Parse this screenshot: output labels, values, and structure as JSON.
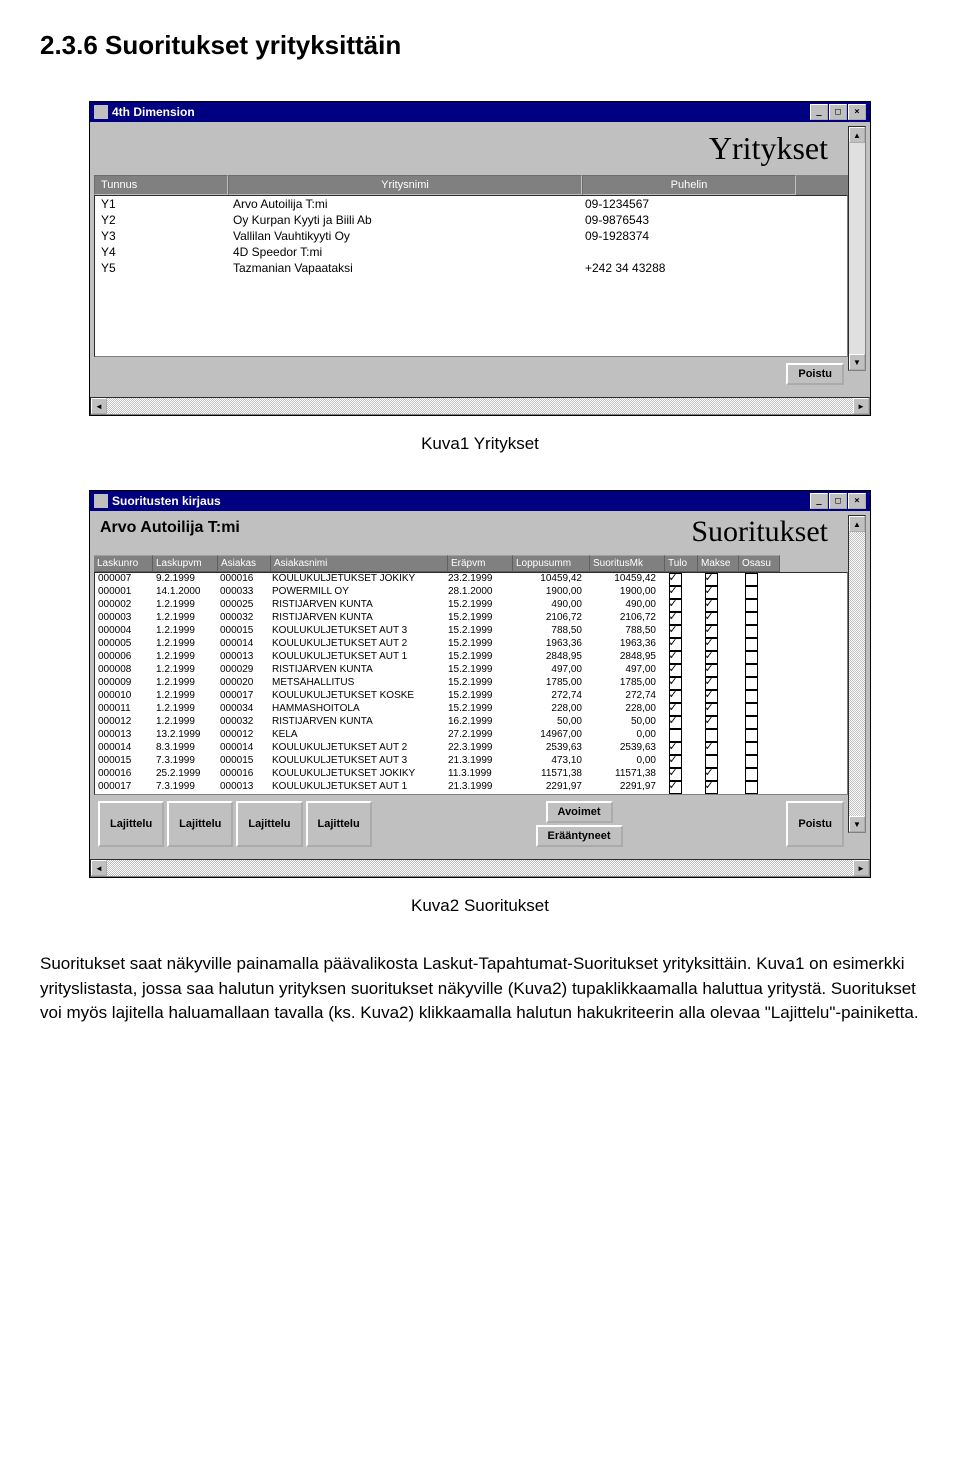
{
  "heading": "2.3.6  Suoritukset yrityksittäin",
  "caption1": "Kuva1 Yritykset",
  "caption2": "Kuva2 Suoritukset",
  "bodytext": "Suoritukset saat näkyville painamalla päävalikosta Laskut-Tapahtumat-Suoritukset yrityksittäin. Kuva1 on esimerkki yrityslistasta, jossa saa halutun yrityksen suoritukset näkyville (Kuva2) tupaklikkaamalla haluttua yritystä. Suoritukset voi myös lajitella haluamallaan tavalla (ks. Kuva2) klikkaamalla halutun hakukriteerin alla olevaa \"Lajittelu\"-painiketta.",
  "win1": {
    "title": "4th Dimension",
    "bigtitle": "Yritykset",
    "headers": [
      "Tunnus",
      "Yritysnimi",
      "Puhelin"
    ],
    "rows": [
      [
        "Y1",
        "Arvo Autoilija T:mi",
        "09-1234567"
      ],
      [
        "Y2",
        "Oy Kurpan Kyyti ja Biili Ab",
        "09-9876543"
      ],
      [
        "Y3",
        "Vallilan Vauhtikyyti Oy",
        "09-1928374"
      ],
      [
        "Y4",
        "4D Speedor T:mi",
        ""
      ],
      [
        "Y5",
        "Tazmanian Vapaataksi",
        "+242 34 43288"
      ]
    ],
    "poistu": "Poistu"
  },
  "win2": {
    "title": "Suoritusten kirjaus",
    "company": "Arvo Autoilija T:mi",
    "bigtitle": "Suoritukset",
    "headers": [
      "Laskunro",
      "Laskupvm",
      "Asiakas",
      "Asiakasnimi",
      "Eräpvm",
      "Loppusumm",
      "SuoritusMk",
      "Tulo",
      "Makse",
      "Osasu"
    ],
    "rows": [
      [
        "000007",
        "9.2.1999",
        "000016",
        "KOULUKULJETUKSET JOKIKY",
        "23.2.1999",
        "10459,42",
        "10459,42",
        true,
        true,
        false
      ],
      [
        "000001",
        "14.1.2000",
        "000033",
        "POWERMILL OY",
        "28.1.2000",
        "1900,00",
        "1900,00",
        true,
        true,
        false
      ],
      [
        "000002",
        "1.2.1999",
        "000025",
        "RISTIJÄRVEN KUNTA",
        "15.2.1999",
        "490,00",
        "490,00",
        true,
        true,
        false
      ],
      [
        "000003",
        "1.2.1999",
        "000032",
        "RISTIJÄRVEN KUNTA",
        "15.2.1999",
        "2106,72",
        "2106,72",
        true,
        true,
        false
      ],
      [
        "000004",
        "1.2.1999",
        "000015",
        "KOULUKULJETUKSET AUT 3",
        "15.2.1999",
        "788,50",
        "788,50",
        true,
        true,
        false
      ],
      [
        "000005",
        "1.2.1999",
        "000014",
        "KOULUKULJETUKSET AUT 2",
        "15.2.1999",
        "1963,36",
        "1963,36",
        true,
        true,
        false
      ],
      [
        "000006",
        "1.2.1999",
        "000013",
        "KOULUKULJETUKSET AUT 1",
        "15.2.1999",
        "2848,95",
        "2848,95",
        true,
        true,
        false
      ],
      [
        "000008",
        "1.2.1999",
        "000029",
        "RISTIJÄRVEN KUNTA",
        "15.2.1999",
        "497,00",
        "497,00",
        true,
        true,
        false
      ],
      [
        "000009",
        "1.2.1999",
        "000020",
        "METSÄHALLITUS",
        "15.2.1999",
        "1785,00",
        "1785,00",
        true,
        true,
        false
      ],
      [
        "000010",
        "1.2.1999",
        "000017",
        "KOULUKULJETUKSET KOSKE",
        "15.2.1999",
        "272,74",
        "272,74",
        true,
        true,
        false
      ],
      [
        "000011",
        "1.2.1999",
        "000034",
        "HAMMASHOITOLA",
        "15.2.1999",
        "228,00",
        "228,00",
        true,
        true,
        false
      ],
      [
        "000012",
        "1.2.1999",
        "000032",
        "RISTIJÄRVEN KUNTA",
        "16.2.1999",
        "50,00",
        "50,00",
        true,
        true,
        false
      ],
      [
        "000013",
        "13.2.1999",
        "000012",
        "KELA",
        "27.2.1999",
        "14967,00",
        "0,00",
        false,
        false,
        false
      ],
      [
        "000014",
        "8.3.1999",
        "000014",
        "KOULUKULJETUKSET AUT 2",
        "22.3.1999",
        "2539,63",
        "2539,63",
        true,
        true,
        false
      ],
      [
        "000015",
        "7.3.1999",
        "000015",
        "KOULUKULJETUKSET AUT 3",
        "21.3.1999",
        "473,10",
        "0,00",
        true,
        false,
        false
      ],
      [
        "000016",
        "25.2.1999",
        "000016",
        "KOULUKULJETUKSET JOKIKY",
        "11.3.1999",
        "11571,38",
        "11571,38",
        true,
        true,
        false
      ],
      [
        "000017",
        "7.3.1999",
        "000013",
        "KOULUKULJETUKSET AUT 1",
        "21.3.1999",
        "2291,97",
        "2291,97",
        true,
        true,
        false
      ]
    ],
    "buttons": {
      "lajittelu": "Lajittelu",
      "avoimet": "Avoimet",
      "eraantyneet": "Erääntyneet",
      "poistu": "Poistu"
    }
  }
}
